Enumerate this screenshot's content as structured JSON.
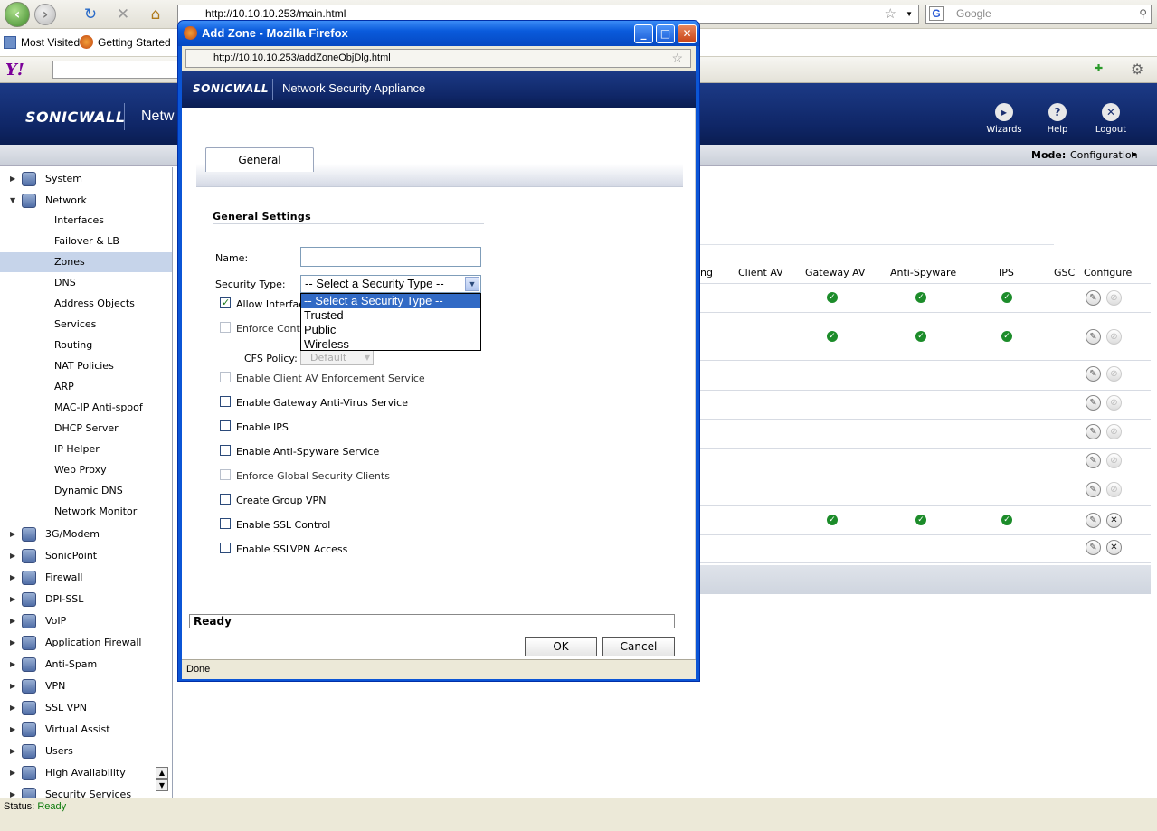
{
  "browser": {
    "url": "http://10.10.10.253/main.html",
    "search_placeholder": "Google",
    "bookmarks": [
      "Most Visited",
      "Getting Started"
    ]
  },
  "header": {
    "logo": "SONICWALL",
    "title": "Netw",
    "wizards": "Wizards",
    "help": "Help",
    "logout": "Logout",
    "mode_label": "Mode:",
    "mode_value": "Configuration"
  },
  "sidebar": {
    "items": [
      {
        "label": "System",
        "type": "top"
      },
      {
        "label": "Network",
        "type": "top-open"
      },
      {
        "label": "Interfaces",
        "type": "sub"
      },
      {
        "label": "Failover & LB",
        "type": "sub"
      },
      {
        "label": "Zones",
        "type": "sub",
        "selected": true
      },
      {
        "label": "DNS",
        "type": "sub"
      },
      {
        "label": "Address Objects",
        "type": "sub"
      },
      {
        "label": "Services",
        "type": "sub"
      },
      {
        "label": "Routing",
        "type": "sub"
      },
      {
        "label": "NAT Policies",
        "type": "sub"
      },
      {
        "label": "ARP",
        "type": "sub"
      },
      {
        "label": "MAC-IP Anti-spoof",
        "type": "sub"
      },
      {
        "label": "DHCP Server",
        "type": "sub"
      },
      {
        "label": "IP Helper",
        "type": "sub"
      },
      {
        "label": "Web Proxy",
        "type": "sub"
      },
      {
        "label": "Dynamic DNS",
        "type": "sub"
      },
      {
        "label": "Network Monitor",
        "type": "sub"
      },
      {
        "label": "3G/Modem",
        "type": "top"
      },
      {
        "label": "SonicPoint",
        "type": "top"
      },
      {
        "label": "Firewall",
        "type": "top"
      },
      {
        "label": "DPI-SSL",
        "type": "top"
      },
      {
        "label": "VoIP",
        "type": "top"
      },
      {
        "label": "Application Firewall",
        "type": "top"
      },
      {
        "label": "Anti-Spam",
        "type": "top"
      },
      {
        "label": "VPN",
        "type": "top"
      },
      {
        "label": "SSL VPN",
        "type": "top"
      },
      {
        "label": "Virtual Assist",
        "type": "top"
      },
      {
        "label": "Users",
        "type": "top"
      },
      {
        "label": "High Availability",
        "type": "top"
      },
      {
        "label": "Security Services",
        "type": "top"
      }
    ]
  },
  "zones_table": {
    "columns": [
      "ng",
      "Client AV",
      "Gateway AV",
      "Anti-Spyware",
      "IPS",
      "GSC",
      "Configure"
    ],
    "rows": [
      {
        "gateway_av": true,
        "anti_spyware": true,
        "ips": true,
        "delete": "disabled"
      },
      {
        "gateway_av": true,
        "anti_spyware": true,
        "ips": true,
        "delete": "disabled"
      },
      {
        "gateway_av": false,
        "anti_spyware": false,
        "ips": false,
        "delete": "disabled"
      },
      {
        "gateway_av": false,
        "anti_spyware": false,
        "ips": false,
        "delete": "disabled"
      },
      {
        "gateway_av": false,
        "anti_spyware": false,
        "ips": false,
        "delete": "disabled"
      },
      {
        "gateway_av": false,
        "anti_spyware": false,
        "ips": false,
        "delete": "disabled"
      },
      {
        "gateway_av": false,
        "anti_spyware": false,
        "ips": false,
        "delete": "disabled"
      },
      {
        "gateway_av": true,
        "anti_spyware": true,
        "ips": true,
        "delete": "enabled"
      },
      {
        "gateway_av": false,
        "anti_spyware": false,
        "ips": false,
        "delete": "enabled"
      }
    ]
  },
  "statusbar": {
    "label": "Status:",
    "value": "Ready"
  },
  "popup": {
    "window_title": "Add Zone - Mozilla Firefox",
    "url": "http://10.10.10.253/addZoneObjDlg.html",
    "logo": "SONICWALL",
    "appliance_title": "Network Security Appliance",
    "tab": "General",
    "section_title": "General Settings",
    "name_label": "Name:",
    "name_value": "",
    "security_type_label": "Security Type:",
    "security_type_value": "-- Select a Security Type --",
    "security_type_options": [
      "-- Select a Security Type --",
      "Trusted",
      "Public",
      "Wireless"
    ],
    "cfs_policy_label": "CFS Policy:",
    "cfs_policy_value": "Default",
    "checkboxes": [
      {
        "label": "Allow Interface Trust",
        "checked": true,
        "enabled": true
      },
      {
        "label": "Enforce Content Filtering Service",
        "checked": false,
        "enabled": false
      },
      {
        "label": "Enable Client AV Enforcement Service",
        "checked": false,
        "enabled": false
      },
      {
        "label": "Enable Gateway Anti-Virus Service",
        "checked": false,
        "enabled": true
      },
      {
        "label": "Enable IPS",
        "checked": false,
        "enabled": true
      },
      {
        "label": "Enable Anti-Spyware Service",
        "checked": false,
        "enabled": true
      },
      {
        "label": "Enforce Global Security Clients",
        "checked": false,
        "enabled": false
      },
      {
        "label": "Create Group VPN",
        "checked": false,
        "enabled": true
      },
      {
        "label": "Enable SSL Control",
        "checked": false,
        "enabled": true
      },
      {
        "label": "Enable SSLVPN Access",
        "checked": false,
        "enabled": true
      }
    ],
    "ready_text": "Ready",
    "ok_label": "OK",
    "cancel_label": "Cancel",
    "status_text": "Done"
  },
  "colors": {
    "header_blue": "#0f2666",
    "selected_row": "#c6d4ea",
    "check_green": "#1c8c2a",
    "xp_title_blue": "#0a5bdc"
  }
}
